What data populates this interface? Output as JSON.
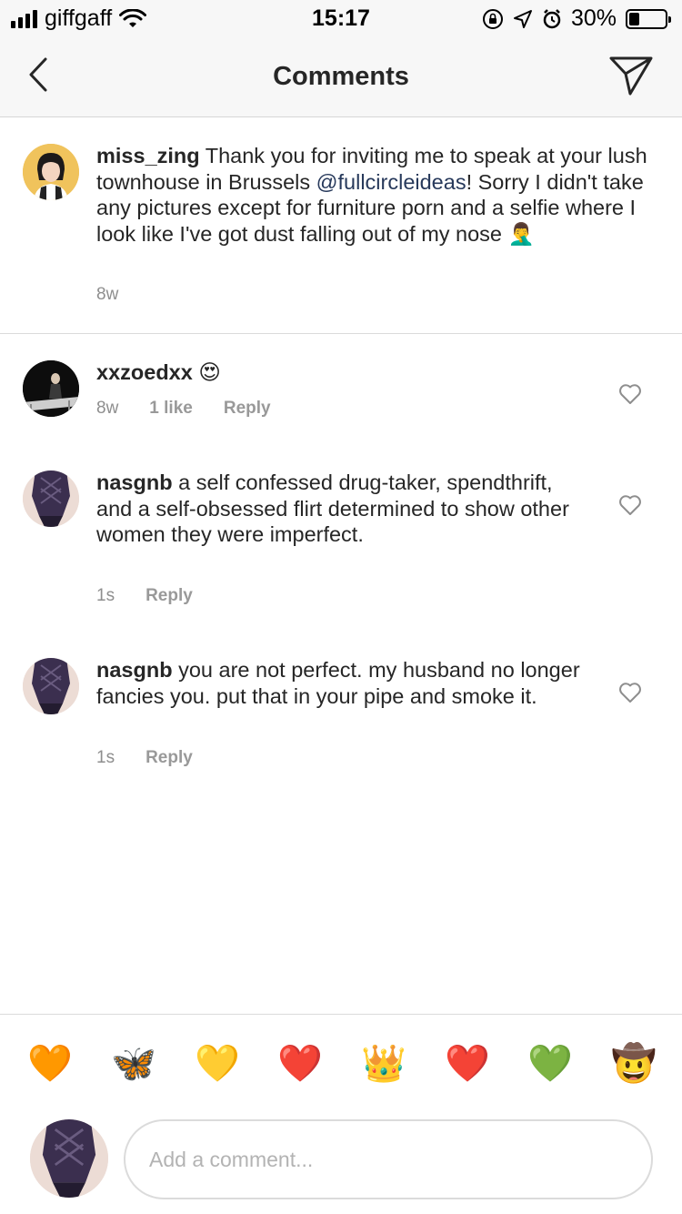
{
  "status_bar": {
    "carrier": "giffgaff",
    "time": "15:17",
    "battery": "30%",
    "battery_level": 0.3
  },
  "nav": {
    "title": "Comments"
  },
  "caption": {
    "username": "miss_zing",
    "text_before": "Thank you for inviting me to speak at your lush townhouse in Brussels ",
    "mention": "@fullcircleideas",
    "text_after": "! Sorry I didn't take any pictures except for furniture porn and a selfie where I look like I've got dust falling out of my nose 🤦‍♂️",
    "time": "8w"
  },
  "comments": [
    {
      "username": "xxzoedxx",
      "text": "😍",
      "time": "8w",
      "likes": "1 like",
      "reply": "Reply"
    },
    {
      "username": "nasgnb",
      "text": "a self confessed drug-taker, spendthrift, and a self-obsessed flirt determined to show other women they were imperfect.",
      "time": "1s",
      "reply": "Reply"
    },
    {
      "username": "nasgnb",
      "text": "you are not perfect. my husband no longer fancies you. put that in your pipe and smoke it.",
      "time": "1s",
      "reply": "Reply"
    }
  ],
  "emoji_bar": [
    "🧡",
    "🦋",
    "💛",
    "❤️",
    "👑",
    "❤️",
    "💚",
    "🤠"
  ],
  "input": {
    "placeholder": "Add a comment..."
  },
  "colors": {
    "mention": "#27395b",
    "secondary_text": "#8e8e8e",
    "divider": "#dbdbdb"
  }
}
